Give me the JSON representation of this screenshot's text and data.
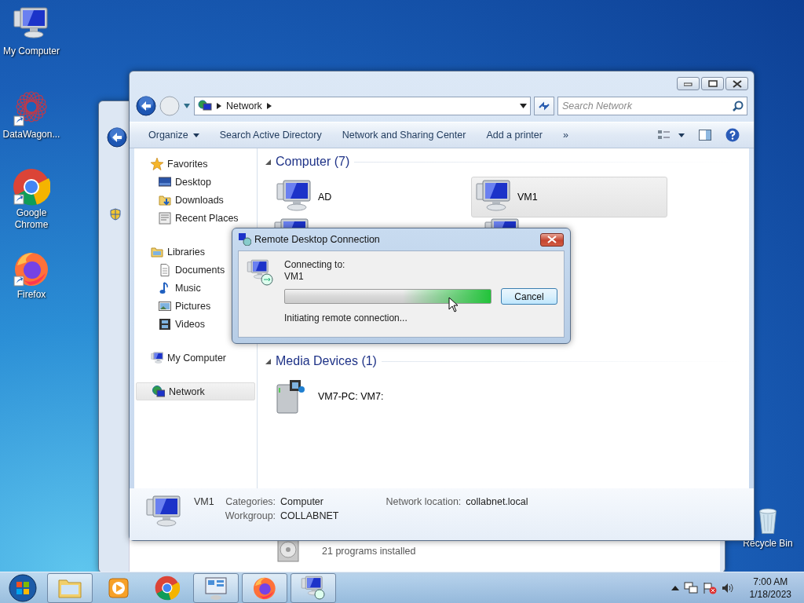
{
  "desktop_icons": [
    {
      "label": "My Computer",
      "kind": "computer",
      "shortcut": false
    },
    {
      "label": "DataWagon...",
      "kind": "web",
      "shortcut": true
    },
    {
      "label": "Google Chrome",
      "kind": "chrome",
      "shortcut": true
    },
    {
      "label": "Firefox",
      "kind": "firefox",
      "shortcut": true
    },
    {
      "label": "Recycle Bin",
      "kind": "bin",
      "shortcut": false
    }
  ],
  "back_window": {
    "status": "21 programs installed"
  },
  "explorer": {
    "address": [
      "Network"
    ],
    "search": {
      "placeholder": "Search Network"
    },
    "toolbar": [
      {
        "label": "Organize",
        "dropdown": true
      },
      {
        "label": "Search Active Directory",
        "dropdown": false
      },
      {
        "label": "Network and Sharing Center",
        "dropdown": false
      },
      {
        "label": "Add a printer",
        "dropdown": false
      }
    ],
    "toolbar_overflow": "»",
    "sidebar": [
      {
        "label": "Favorites",
        "kind": "star",
        "selected": false,
        "children": [
          {
            "label": "Desktop",
            "kind": "desktop",
            "selected": false
          },
          {
            "label": "Downloads",
            "kind": "downloads",
            "selected": false
          },
          {
            "label": "Recent Places",
            "kind": "recent",
            "selected": false
          }
        ]
      },
      {
        "label": "Libraries",
        "kind": "libraries",
        "selected": false,
        "children": [
          {
            "label": "Documents",
            "kind": "documents",
            "selected": false
          },
          {
            "label": "Music",
            "kind": "music",
            "selected": false
          },
          {
            "label": "Pictures",
            "kind": "pictures",
            "selected": false
          },
          {
            "label": "Videos",
            "kind": "videos",
            "selected": false
          }
        ]
      },
      {
        "label": "My Computer",
        "kind": "computer",
        "selected": false
      },
      {
        "label": "Network",
        "kind": "network",
        "selected": true
      }
    ],
    "groups": [
      {
        "title": "Computer (7)",
        "expanded": true,
        "items": [
          {
            "label": "AD",
            "kind": "computer",
            "selected": false
          },
          {
            "label": "VM1",
            "kind": "computer",
            "selected": true
          }
        ]
      },
      {
        "title": "Media Devices (1)",
        "expanded": true,
        "items": [
          {
            "label": "VM7-PC: VM7:",
            "kind": "media",
            "selected": false
          }
        ]
      }
    ],
    "details": {
      "name": "VM1",
      "fields": [
        {
          "label": "Categories:",
          "value": "Computer"
        },
        {
          "label": "Workgroup:",
          "value": "COLLABNET"
        },
        {
          "label": "Network location:",
          "value": "collabnet.local"
        }
      ]
    }
  },
  "dialog": {
    "title": "Remote Desktop Connection",
    "lines": [
      "Connecting to:",
      "VM1"
    ],
    "progress": {
      "level": 1
    },
    "status": "Initiating remote connection...",
    "button": "Cancel"
  },
  "taskbar": {
    "apps": [
      {
        "kind": "explorer",
        "running": true
      },
      {
        "kind": "media",
        "running": false
      },
      {
        "kind": "chrome",
        "running": false
      },
      {
        "kind": "control",
        "running": true
      },
      {
        "kind": "firefox",
        "running": true
      },
      {
        "kind": "rdp",
        "running": true
      }
    ],
    "time": "7:00 AM",
    "date": "1/18/2023"
  }
}
